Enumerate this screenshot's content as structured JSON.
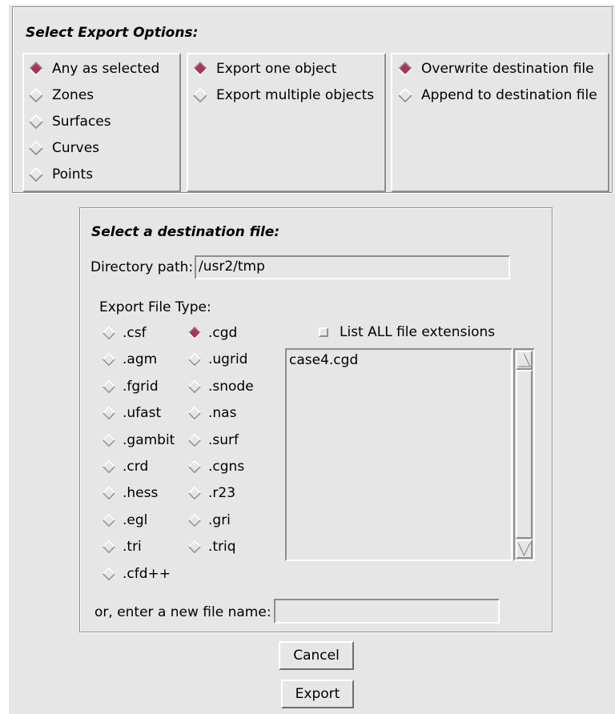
{
  "export_options": {
    "title": "Select Export Options:",
    "selection_group": {
      "items": [
        {
          "label": "Any as selected",
          "selected": true
        },
        {
          "label": "Zones",
          "selected": false
        },
        {
          "label": "Surfaces",
          "selected": false
        },
        {
          "label": "Curves",
          "selected": false
        },
        {
          "label": "Points",
          "selected": false
        }
      ]
    },
    "object_group": {
      "items": [
        {
          "label": "Export one object",
          "selected": true
        },
        {
          "label": "Export multiple objects",
          "selected": false
        }
      ]
    },
    "file_mode_group": {
      "items": [
        {
          "label": "Overwrite destination file",
          "selected": true
        },
        {
          "label": "Append to destination file",
          "selected": false
        }
      ]
    }
  },
  "destination": {
    "title": "Select a destination file:",
    "directory_label": "Directory path:",
    "directory_value": "/usr2/tmp",
    "file_type_label": "Export File Type:",
    "file_types_col1": [
      {
        "label": ".csf",
        "selected": false
      },
      {
        "label": ".agm",
        "selected": false
      },
      {
        "label": ".fgrid",
        "selected": false
      },
      {
        "label": ".ufast",
        "selected": false
      },
      {
        "label": ".gambit",
        "selected": false
      },
      {
        "label": ".crd",
        "selected": false
      },
      {
        "label": ".hess",
        "selected": false
      },
      {
        "label": ".egl",
        "selected": false
      },
      {
        "label": ".tri",
        "selected": false
      },
      {
        "label": ".cfd++",
        "selected": false
      }
    ],
    "file_types_col2": [
      {
        "label": ".cgd",
        "selected": true
      },
      {
        "label": ".ugrid",
        "selected": false
      },
      {
        "label": ".snode",
        "selected": false
      },
      {
        "label": ".nas",
        "selected": false
      },
      {
        "label": ".surf",
        "selected": false
      },
      {
        "label": ".cgns",
        "selected": false
      },
      {
        "label": ".r23",
        "selected": false
      },
      {
        "label": ".gri",
        "selected": false
      },
      {
        "label": ".triq",
        "selected": false
      }
    ],
    "list_all_label": "List ALL file extensions",
    "list_all_checked": false,
    "files": [
      "case4.cgd"
    ],
    "new_file_label": "or, enter a new file name:",
    "new_file_value": ""
  },
  "buttons": {
    "cancel": "Cancel",
    "export": "Export"
  },
  "colors": {
    "background": "#e6e6e6",
    "radio_selected": "#b03060",
    "shadow": "#8e8e8e",
    "highlight": "#ffffff"
  }
}
